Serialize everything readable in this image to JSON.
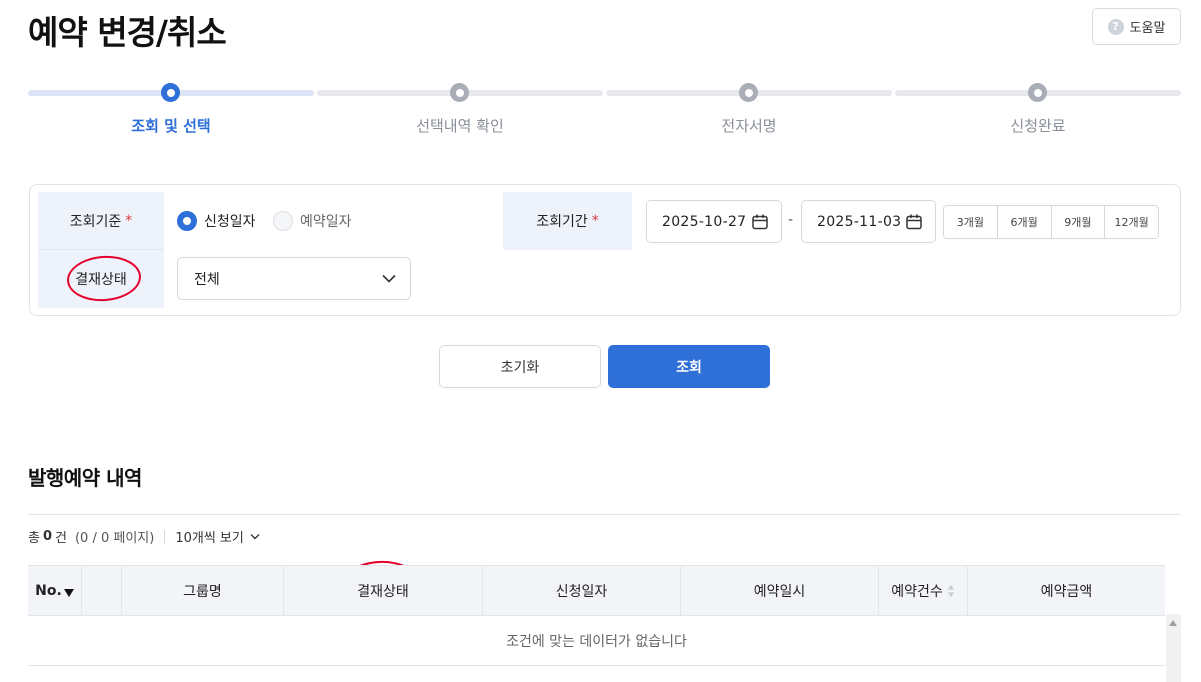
{
  "page": {
    "title": "예약 변경/취소",
    "help_label": "도움말",
    "help_icon": "question-icon"
  },
  "stepper": {
    "steps": [
      {
        "label": "조회 및 선택",
        "active": true
      },
      {
        "label": "선택내역 확인",
        "active": false
      },
      {
        "label": "전자서명",
        "active": false
      },
      {
        "label": "신청완료",
        "active": false
      }
    ]
  },
  "search": {
    "criteria_label": "조회기준",
    "required_mark": "*",
    "radio_options": [
      {
        "label": "신청일자",
        "selected": true
      },
      {
        "label": "예약일자",
        "selected": false
      }
    ],
    "period_label": "조회기간",
    "date_from": "2025-10-27",
    "date_to": "2025-11-03",
    "date_separator": "-",
    "period_buttons": [
      "3개월",
      "6개월",
      "9개월",
      "12개월"
    ],
    "status_label": "결재상태",
    "status_select_value": "전체"
  },
  "actions": {
    "reset_label": "초기화",
    "search_label": "조회"
  },
  "results": {
    "section_title": "발행예약 내역",
    "total_prefix": "총",
    "total_count": "0",
    "total_suffix": "건",
    "page_info": "(0 / 0 페이지)",
    "per_page_label": "10개씩 보기",
    "columns": [
      "No.",
      "",
      "그룹명",
      "결재상태",
      "신청일자",
      "예약일시",
      "예약건수",
      "예약금액"
    ],
    "empty_message": "조건에 맞는 데이터가 없습니다"
  },
  "colors": {
    "accent": "#2f6fd8",
    "annotation": "#e4002b",
    "label_bg": "#eef3fb"
  }
}
